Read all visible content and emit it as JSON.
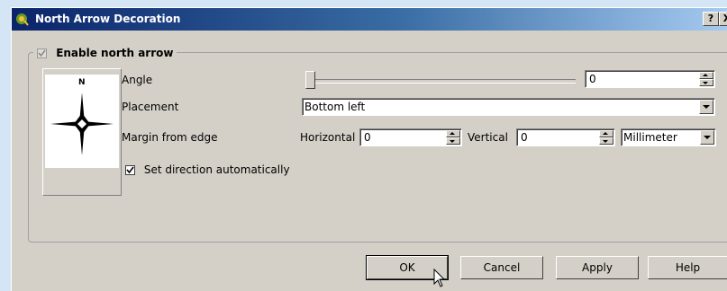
{
  "window": {
    "title": "North Arrow Decoration",
    "help_button": "?",
    "close_button": "X"
  },
  "enable": {
    "label": "Enable north arrow",
    "checked": true
  },
  "preview": {
    "north_letter": "N"
  },
  "angle": {
    "label": "Angle",
    "value": "0",
    "slider_fraction": 0
  },
  "placement": {
    "label": "Placement",
    "value": "Bottom left"
  },
  "margin": {
    "label": "Margin from edge",
    "horizontal_label": "Horizontal",
    "horizontal_value": "0",
    "vertical_label": "Vertical",
    "vertical_value": "0",
    "unit": "Millimeter"
  },
  "auto_direction": {
    "label": "Set direction automatically",
    "checked": true
  },
  "buttons": {
    "ok": "OK",
    "cancel": "Cancel",
    "apply": "Apply",
    "help": "Help"
  }
}
